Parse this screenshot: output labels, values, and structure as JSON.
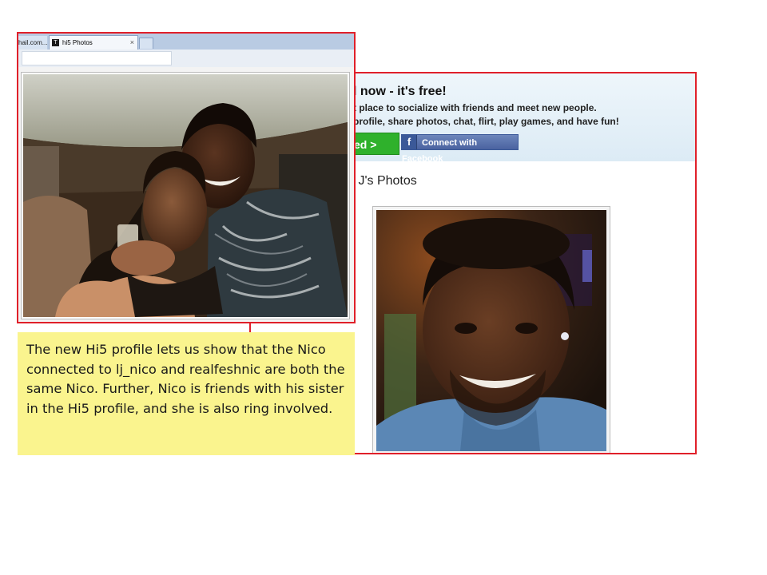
{
  "colors": {
    "frame_border": "#e0202a",
    "caption_bg": "#faf48e",
    "get_started_green": "#2fb12c",
    "facebook_blue": "#3b5998"
  },
  "right_screenshot": {
    "banner_title": "l now - it's free!",
    "banner_line1": "t place to socialize with friends and meet new people.",
    "banner_line2": "profile, share photos, chat, flirt, play games, and have fun!",
    "get_started_label": "ed >",
    "facebook_icon": "f",
    "facebook_label": "Connect with Facebook",
    "photos_heading": "y J's Photos",
    "profile_photo_icon": "photo-icon"
  },
  "left_screenshot": {
    "tabs": [
      {
        "label": "hail.com..."
      },
      {
        "label": "hi5 Photos",
        "favicon": "T",
        "close": "×"
      }
    ],
    "group_photo_icon": "photo-icon"
  },
  "caption": {
    "text": "The new Hi5 profile lets us show that the Nico connected to lj_nico and realfeshnic are both the same Nico.  Further, Nico is friends with his sister in the Hi5 profile, and she is also ring involved."
  }
}
